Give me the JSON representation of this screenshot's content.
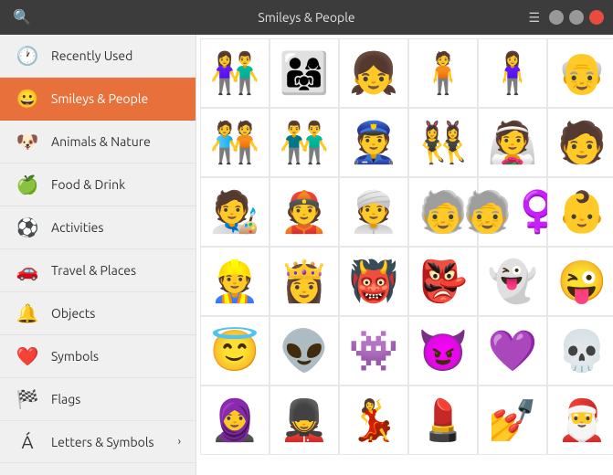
{
  "titlebar": {
    "title": "Smileys & People",
    "search_icon": "🔍",
    "menu_icon": "☰"
  },
  "sidebar": {
    "items": [
      {
        "id": "recently-used",
        "label": "Recently Used",
        "icon": "🕐",
        "active": false
      },
      {
        "id": "smileys-people",
        "label": "Smileys & People",
        "icon": "😀",
        "active": true
      },
      {
        "id": "animals-nature",
        "label": "Animals & Nature",
        "icon": "🐶",
        "active": false
      },
      {
        "id": "food-drink",
        "label": "Food & Drink",
        "icon": "🍏",
        "active": false
      },
      {
        "id": "activities",
        "label": "Activities",
        "icon": "⚽",
        "active": false
      },
      {
        "id": "travel-places",
        "label": "Travel & Places",
        "icon": "🚗",
        "active": false
      },
      {
        "id": "objects",
        "label": "Objects",
        "icon": "🔔",
        "active": false
      },
      {
        "id": "symbols",
        "label": "Symbols",
        "icon": "❤️",
        "active": false
      },
      {
        "id": "flags",
        "label": "Flags",
        "icon": "🏁",
        "active": false
      },
      {
        "id": "letters-symbols",
        "label": "Letters & Symbols",
        "icon": "Á",
        "active": false,
        "has_arrow": true
      }
    ]
  },
  "emoji_grid": {
    "emojis": [
      "👫",
      "👨‍👩‍👧",
      "👧",
      "🧍",
      "🧍‍♀️",
      "👴",
      "🧑‍🤝‍🧑",
      "👬",
      "👮",
      "👯‍♀️",
      "👰",
      "🧑",
      "🧑‍🎨",
      "👲",
      "👳",
      "🧓",
      "🧓‍♀️",
      "👶",
      "👷",
      "👸",
      "👹",
      "👺",
      "👻",
      "😜",
      "😇",
      "👽",
      "👾",
      "😈",
      "💜",
      "💀",
      "🧕",
      "💂",
      "💃",
      "💄",
      "💅",
      "🎅"
    ]
  },
  "colors": {
    "active_bg": "#e8703a",
    "sidebar_bg": "#f0f0f0",
    "titlebar_bg": "#3c3c3c"
  }
}
